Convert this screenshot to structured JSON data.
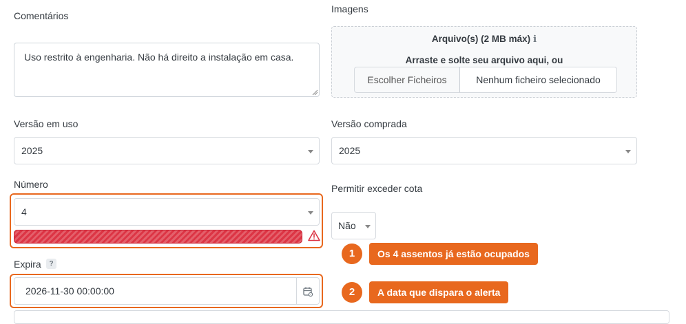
{
  "comments": {
    "label": "Comentários",
    "value": "Uso restrito à engenharia. Não há direito a instalação em casa."
  },
  "images": {
    "label": "Imagens",
    "title": "Arquivo(s) (2 MB máx)",
    "info_icon": "ℹ",
    "drop_hint": "Arraste e solte seu arquivo aqui, ou",
    "choose_button": "Escolher Ficheiros",
    "no_file": "Nenhum ficheiro selecionado"
  },
  "version_in_use": {
    "label": "Versão em uso",
    "value": "2025"
  },
  "version_bought": {
    "label": "Versão comprada",
    "value": "2025"
  },
  "number": {
    "label": "Número",
    "value": "4",
    "warning_icon": "warning-triangle-icon"
  },
  "allow_exceed": {
    "label": "Permitir exceder cota",
    "value": "Não"
  },
  "expires": {
    "label": "Expira",
    "help": "?",
    "value": "2026-11-30 00:00:00",
    "calendar_icon": "calendar-icon"
  },
  "callouts": [
    {
      "number": "1",
      "text": "Os 4 assentos já estão ocupados"
    },
    {
      "number": "2",
      "text": "A data que dispara o alerta"
    }
  ],
  "colors": {
    "accent": "#e8681e",
    "danger": "#dc3545"
  }
}
